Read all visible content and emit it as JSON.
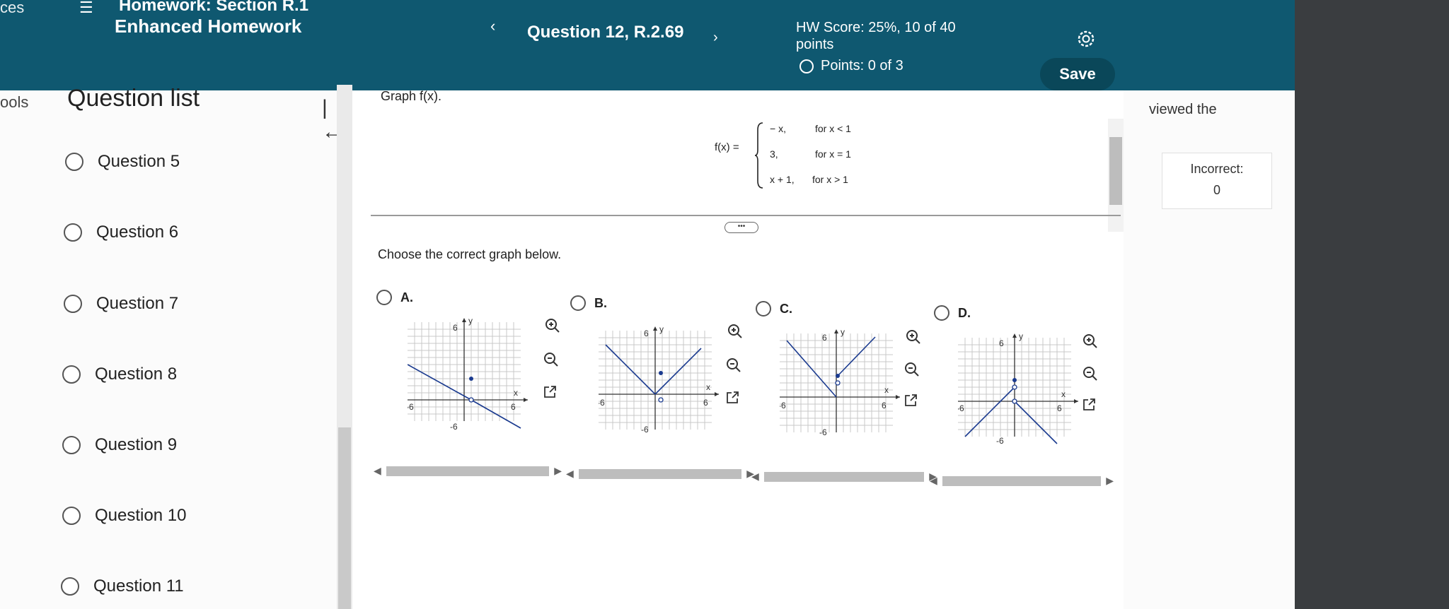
{
  "header": {
    "top_cut_text": "ces",
    "hamburger": "☰",
    "section_title": "Homework: Section R.1",
    "assignment_title": "Enhanced Homework",
    "prev_arrow": "‹",
    "question_title": "Question 12, R.2.69",
    "next_arrow": "›",
    "hw_score_line1": "HW Score: 25%, 10 of 40",
    "hw_score_line2": "points",
    "points": "Points: 0 of 3",
    "save_label": "Save"
  },
  "left": {
    "tools_cut": "ools",
    "title": "Question list",
    "collapse_icon": "|←",
    "questions": [
      "Question 5",
      "Question 6",
      "Question 7",
      "Question 8",
      "Question 9",
      "Question 10",
      "Question 11"
    ]
  },
  "question": {
    "prompt": "Graph f(x).",
    "fx_label": "f(x) =",
    "pieces": [
      {
        "expr": "− x,",
        "cond": "for x < 1"
      },
      {
        "expr": "3,",
        "cond": "for x = 1"
      },
      {
        "expr": "x + 1,",
        "cond": "for x > 1"
      }
    ],
    "more_button": "•••",
    "choose_text": "Choose the correct graph below.",
    "options": [
      {
        "letter": "A.",
        "tick_pos": "6",
        "tick_neg": "-6",
        "y_label": "y",
        "x_label": "x"
      },
      {
        "letter": "B.",
        "tick_pos": "6",
        "tick_neg": "-6",
        "y_label": "y",
        "x_label": "x"
      },
      {
        "letter": "C.",
        "tick_pos": "6",
        "tick_neg": "-6",
        "y_label": "y",
        "x_label": "x"
      },
      {
        "letter": "D.",
        "tick_pos": "6",
        "tick_neg": "-6",
        "y_label": "y",
        "x_label": "x"
      }
    ]
  },
  "right_panel": {
    "viewed_text": "viewed the",
    "incorrect_label": "Incorrect:",
    "incorrect_value": "0"
  },
  "colors": {
    "header_bg": "#0f5870",
    "save_bg": "#0a4759",
    "graph_line": "#1a3a8f",
    "grid": "#c8c8c8"
  }
}
